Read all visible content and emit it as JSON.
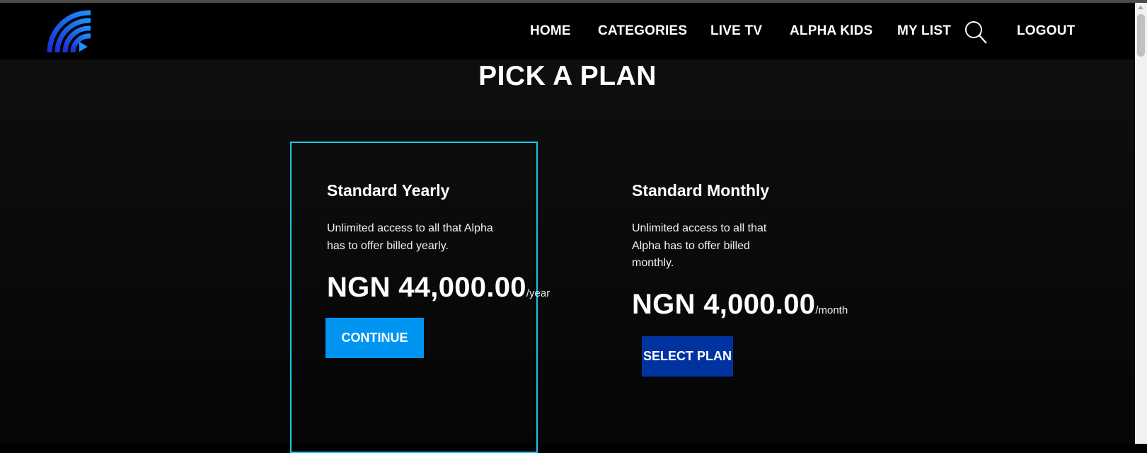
{
  "nav": {
    "items": [
      {
        "label": "HOME"
      },
      {
        "label": "CATEGORIES"
      },
      {
        "label": "LIVE TV"
      },
      {
        "label": "ALPHA KIDS"
      },
      {
        "label": "MY LIST"
      },
      {
        "label": "LOGOUT"
      }
    ],
    "logo_icon": "alpha-wifi-play-logo",
    "search_icon": "search-icon"
  },
  "title": "PICK A PLAN",
  "plans": [
    {
      "name": "Standard Yearly",
      "description": "Unlimited access to all that Alpha has to offer billed yearly.",
      "price": "NGN 44,000.00",
      "period": "/year",
      "button": "CONTINUE",
      "selected": true
    },
    {
      "name": "Standard Monthly",
      "description": "Unlimited access to all that Alpha has to offer billed monthly.",
      "price": "NGN 4,000.00",
      "period": "/month",
      "button": "SELECT PLAN",
      "selected": false
    }
  ],
  "colors": {
    "accent_border": "#18c8e6",
    "continue_button": "#0095f0",
    "select_button": "#0033a0",
    "logo_gradient_start": "#1b3dd8",
    "logo_gradient_end": "#1e90ff"
  }
}
